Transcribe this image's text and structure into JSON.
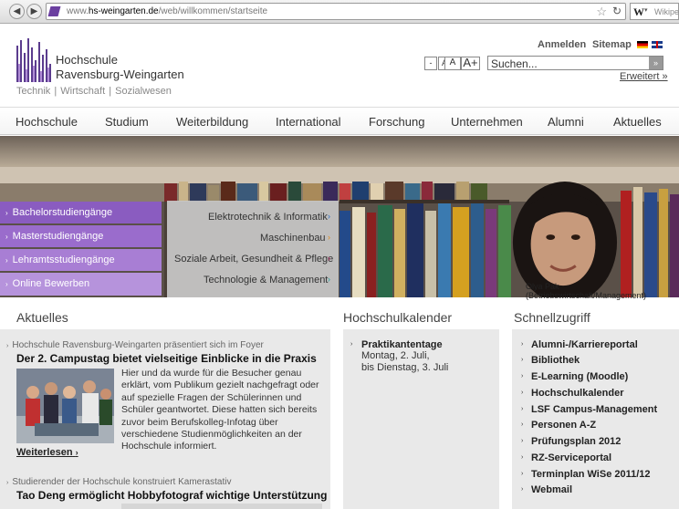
{
  "browser": {
    "url_prefix": "www.",
    "url_domain": "hs-weingarten.de",
    "url_path": "/web/willkommen/startseite",
    "search_engine_label": "W",
    "search_placeholder": "Wikiped"
  },
  "header": {
    "logo_line1": "Hochschule",
    "logo_line2": "Ravensburg-Weingarten",
    "logo_tagline": "Technik  | Wirtschaft | Sozialwesen",
    "login": "Anmelden",
    "sitemap": "Sitemap",
    "font_minus": "-",
    "font_small": "A",
    "font_mid": "A",
    "font_large": "A+",
    "search_placeholder": "Suchen...",
    "search_button": "»",
    "advanced": "Erweitert »"
  },
  "nav": {
    "items": [
      "Hochschule",
      "Studium",
      "Weiterbildung",
      "International",
      "Forschung",
      "Unternehmen",
      "Alumni",
      "Aktuelles"
    ]
  },
  "hero": {
    "caption": "Olya Pak (Betriebswirtschaft/Management)",
    "study_links": [
      "Bachelorstudiengänge",
      "Masterstudiengänge",
      "Lehramtsstudiengänge",
      "Online Bewerben"
    ],
    "faculties": [
      "Elektrotechnik & Informatik",
      "Maschinenbau",
      "Soziale Arbeit, Gesundheit & Pflege",
      "Technologie & Management"
    ],
    "arrow": "›"
  },
  "news": {
    "heading": "Aktuelles",
    "item1_sub": "Hochschule Ravensburg-Weingarten präsentiert sich im Foyer",
    "item1_title": "Der 2. Campustag bietet vielseitige Einblicke in die Praxis",
    "item1_text": "Hier und da wurde für die Besucher genau erklärt, vom Publikum gezielt nachgefragt oder auf spezielle Fragen der Schülerinnen und Schüler geantwortet. Diese hatten sich bereits zuvor beim Berufskolleg-Infotag über verschiedene Studienmöglichkeiten an der Hochschule informiert.",
    "read_more": "Weiterlesen",
    "read_more_arrow": "›",
    "item2_sub": "Studierender der Hochschule konstruiert Kamerastativ",
    "item2_title": "Tao Deng ermöglicht Hobbyfotograf wichtige Unterstützung",
    "bullet": "›"
  },
  "calendar": {
    "heading": "Hochschulkalender",
    "event_title": "Praktikantentage",
    "event_line2": "Montag, 2. Juli,",
    "event_line3": "bis Dienstag, 3. Juli",
    "bullet": "›"
  },
  "quicklinks": {
    "heading": "Schnellzugriff",
    "items": [
      "Alumni-/Karriereportal",
      "Bibliothek",
      "E-Learning (Moodle)",
      "Hochschulkalender",
      "LSF Campus-Management",
      "Personen A-Z",
      "Prüfungsplan 2012",
      "RZ-Serviceportal",
      "Terminplan WiSe 2011/12",
      "Webmail"
    ],
    "bullet": "›"
  },
  "colors": {
    "purple_dark": "#8a5cc0",
    "purple_light": "#b58fdb",
    "accent_blue": "#2b6cc4"
  }
}
